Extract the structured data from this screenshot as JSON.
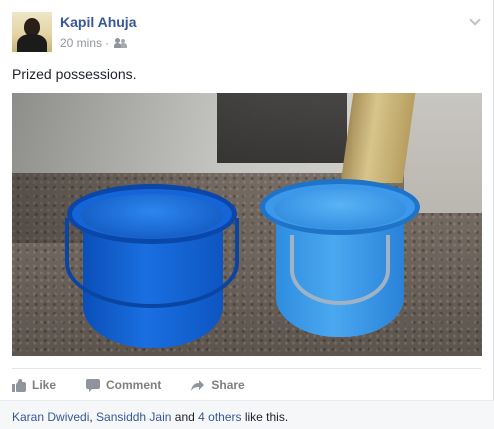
{
  "post": {
    "author": "Kapil Ahuja",
    "time": "20 mins",
    "separator": "·",
    "status": "Prized possessions.",
    "privacy_icon": "friends-icon",
    "options_icon": "chevron-down-icon"
  },
  "actions": {
    "like_label": "Like",
    "comment_label": "Comment",
    "share_label": "Share"
  },
  "likes": {
    "name1": "Karan Dwivedi",
    "comma": ", ",
    "name2": "Sansiddh Jain",
    "and": " and ",
    "others": "4 others",
    "suffix": " like this."
  },
  "colors": {
    "link": "#365899",
    "muted": "#90949c"
  }
}
